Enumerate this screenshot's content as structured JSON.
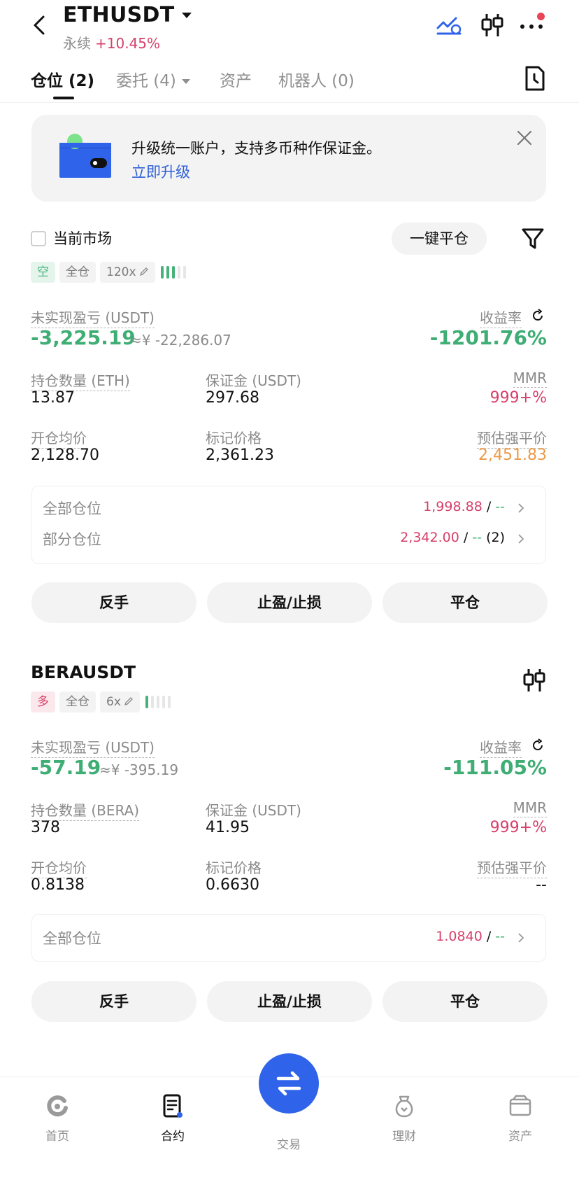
{
  "header": {
    "pair": "ETHUSDT",
    "type": "永续",
    "change": "+10.45%"
  },
  "tabs": [
    {
      "label": "仓位 (2)",
      "active": true
    },
    {
      "label": "委托 (4)",
      "active": false
    },
    {
      "label": "资产",
      "active": false
    },
    {
      "label": "机器人 (0)",
      "active": false
    }
  ],
  "banner": {
    "text": "升级统一账户，支持多币种作保证金。",
    "link": "立即升级"
  },
  "filter": {
    "current_market_label": "当前市场",
    "close_all_label": "一键平仓"
  },
  "positions": [
    {
      "side": "空",
      "margin_mode": "全仓",
      "leverage": "120x",
      "risk_bars_on": 3,
      "pnl_label": "未实现盈亏 (USDT)",
      "pnl": "-3,225.19",
      "pnl_cny": "≈¥ -22,286.07",
      "roe_label": "收益率",
      "roe": "-1201.76%",
      "size_label": "持仓数量 (ETH)",
      "size": "13.87",
      "margin_label": "保证金 (USDT)",
      "margin": "297.68",
      "mmr_label": "MMR",
      "mmr": "999+%",
      "entry_label": "开仓均价",
      "entry": "2,128.70",
      "mark_label": "标记价格",
      "mark": "2,361.23",
      "liq_label": "预估强平价",
      "liq": "2,451.83",
      "summary": [
        {
          "label": "全部仓位",
          "price": "1,998.88",
          "sep": "/",
          "rest": "--",
          "count": ""
        },
        {
          "label": "部分仓位",
          "price": "2,342.00",
          "sep": "/",
          "rest": "--",
          "count": "(2)"
        }
      ],
      "buttons": [
        "反手",
        "止盈/止损",
        "平仓"
      ]
    },
    {
      "symbol": "BERAUSDT",
      "side": "多",
      "margin_mode": "全仓",
      "leverage": "6x",
      "risk_bars_on": 1,
      "pnl_label": "未实现盈亏 (USDT)",
      "pnl": "-57.19",
      "pnl_cny": "≈¥ -395.19",
      "roe_label": "收益率",
      "roe": "-111.05%",
      "size_label": "持仓数量 (BERA)",
      "size": "378",
      "margin_label": "保证金 (USDT)",
      "margin": "41.95",
      "mmr_label": "MMR",
      "mmr": "999+%",
      "entry_label": "开仓均价",
      "entry": "0.8138",
      "mark_label": "标记价格",
      "mark": "0.6630",
      "liq_label": "预估强平价",
      "liq": "--",
      "summary": [
        {
          "label": "全部仓位",
          "price": "1.0840",
          "sep": "/",
          "rest": "--",
          "count": ""
        }
      ],
      "buttons": [
        "反手",
        "止盈/止损",
        "平仓"
      ]
    }
  ],
  "bottom_nav": [
    {
      "label": "首页",
      "icon": "home-icon",
      "active": false
    },
    {
      "label": "合约",
      "icon": "contract-icon",
      "active": true
    },
    {
      "label": "交易",
      "icon": "swap-icon",
      "active": false
    },
    {
      "label": "理财",
      "icon": "finance-icon",
      "active": false
    },
    {
      "label": "资产",
      "icon": "wallet-icon",
      "active": false
    }
  ],
  "colors": {
    "green": "#3fae74",
    "red": "#d6406a",
    "orange": "#eb9a47",
    "blue": "#2f63ea"
  }
}
